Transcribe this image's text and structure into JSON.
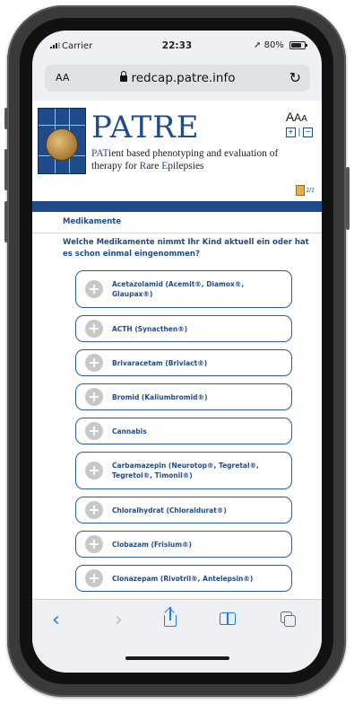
{
  "status": {
    "carrier": "Carrier",
    "time": "22:33",
    "battery": "80%"
  },
  "browser": {
    "text_size_label": "AA",
    "url": "redcap.patre.info",
    "toolbar": {
      "back": "‹",
      "forward": "›"
    }
  },
  "header": {
    "brand": "PATRE",
    "tagline_parts": [
      "PAT",
      "ient based phenotyping and evaluation of therapy for ",
      "R",
      "are ",
      "E",
      "pilepsies"
    ],
    "font_size_letters": [
      "A",
      "A",
      "A"
    ],
    "font_controls": {
      "increase": "+",
      "separator": "|",
      "decrease": "−"
    },
    "page_indicator": "2/2"
  },
  "form": {
    "section_title": "Medikamente",
    "question": "Welche Medikamente nimmt Ihr Kind aktuell ein oder hat es schon einmal eingenommen?",
    "option_icon": "+",
    "options": [
      "Acetazolamid (Acemit®, Diamox®, Glaupax®)",
      "ACTH (Synacthen®)",
      "Brivaracetam (Briviact®)",
      "Bromid (Kaliumbromid®)",
      "Cannabis",
      "Carbamazepin (Neurotop®, Tegretal®, Tegretol®, Timonil®)",
      "Chloralhydrat (Chloraldurat®)",
      "Clobazam (Frisium®)",
      "Clonazepam (Rivotril®, Antelepsin®)"
    ]
  },
  "colors": {
    "brand_blue": "#1f4b8a",
    "safari_blue": "#1a7cf5",
    "plus_grey": "#c8c8c8"
  }
}
